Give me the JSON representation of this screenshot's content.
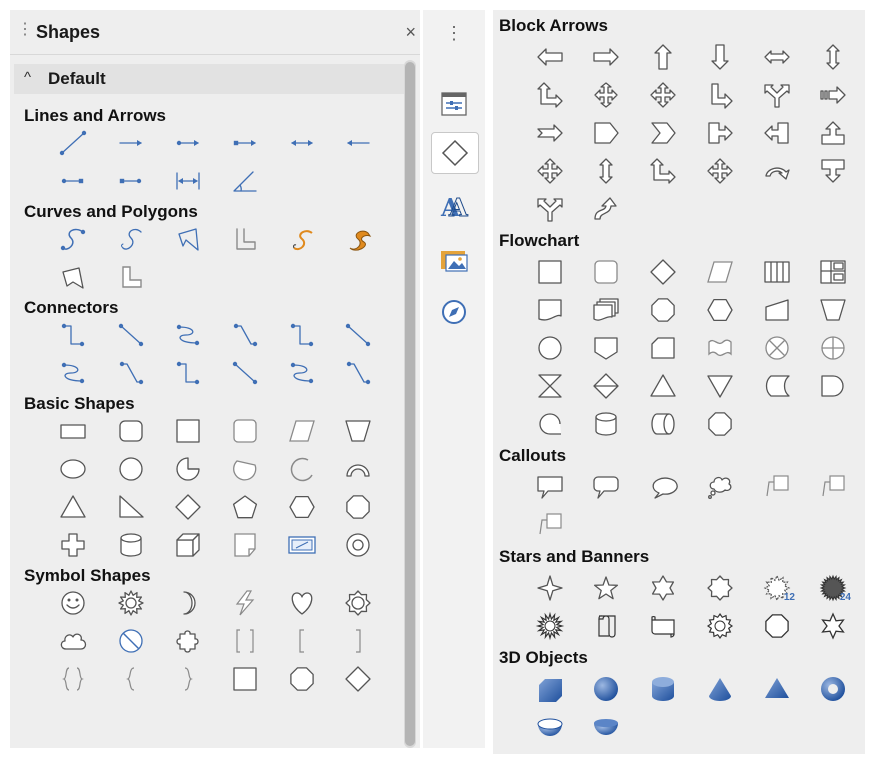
{
  "panel": {
    "title": "Shapes",
    "close_label": "×",
    "group_label": "Default"
  },
  "sidebar_tabs": [
    "properties",
    "shapes",
    "styles",
    "gallery",
    "navigator"
  ],
  "left_sections": [
    {
      "title": "Lines and Arrows",
      "shapes": [
        {
          "name": "line-icon",
          "icon": "line"
        },
        {
          "name": "line-ends-arrow-icon",
          "icon": "arrowR"
        },
        {
          "name": "line-starts-circle-arrow-icon",
          "icon": "circArrow"
        },
        {
          "name": "line-starts-square-arrow-icon",
          "icon": "sqArrow"
        },
        {
          "name": "line-arrows-both-icon",
          "icon": "dblArrow"
        },
        {
          "name": "line-starts-arrow-icon",
          "icon": "arrowL"
        },
        {
          "name": "line-circle-square-icon",
          "icon": "circSq"
        },
        {
          "name": "line-square-circle-icon",
          "icon": "sqCirc"
        },
        {
          "name": "dimension-line-icon",
          "icon": "dimLine"
        },
        {
          "name": "line-angle-icon",
          "icon": "angle"
        }
      ]
    },
    {
      "title": "Curves and Polygons",
      "shapes": [
        {
          "name": "curve-icon",
          "icon": "curve"
        },
        {
          "name": "curve-outline-icon",
          "icon": "curveOutline"
        },
        {
          "name": "polygon-icon",
          "icon": "polygon"
        },
        {
          "name": "polygon-45-icon",
          "icon": "poly45"
        },
        {
          "name": "freeform-line-icon",
          "icon": "freeform"
        },
        {
          "name": "freeform-filled-icon",
          "icon": "freeformFilled"
        },
        {
          "name": "polygon-filled-icon",
          "icon": "polygonFilled"
        },
        {
          "name": "polygon-45-filled-icon",
          "icon": "poly45Filled"
        }
      ]
    },
    {
      "title": "Connectors",
      "shapes": [
        {
          "name": "connector-icon",
          "icon": "conn1"
        },
        {
          "name": "straight-connector-icon",
          "icon": "conn2"
        },
        {
          "name": "curved-connector-icon",
          "icon": "conn3"
        },
        {
          "name": "line-connector-icon",
          "icon": "conn4"
        },
        {
          "name": "connector-ends-arrow-icon",
          "icon": "conn1"
        },
        {
          "name": "straight-connector-arrow-icon",
          "icon": "conn2"
        },
        {
          "name": "curved-connector-arrow-icon",
          "icon": "conn3"
        },
        {
          "name": "line-connector-arrow-icon",
          "icon": "conn4"
        },
        {
          "name": "connector-circles-icon",
          "icon": "conn1"
        },
        {
          "name": "straight-connector-circles-icon",
          "icon": "conn2"
        },
        {
          "name": "curved-connector-circles-icon",
          "icon": "conn3"
        },
        {
          "name": "line-connector-circles-icon",
          "icon": "conn4"
        }
      ]
    },
    {
      "title": "Basic Shapes",
      "shapes": [
        {
          "name": "rectangle-icon",
          "icon": "rect"
        },
        {
          "name": "rounded-rectangle-icon",
          "icon": "roundRect"
        },
        {
          "name": "square-icon",
          "icon": "square"
        },
        {
          "name": "rounded-square-icon",
          "icon": "roundSquare"
        },
        {
          "name": "parallelogram-icon",
          "icon": "parallelogram"
        },
        {
          "name": "trapezoid-icon",
          "icon": "trapezoid"
        },
        {
          "name": "ellipse-icon",
          "icon": "ellipse"
        },
        {
          "name": "circle-icon",
          "icon": "circle"
        },
        {
          "name": "circle-pie-icon",
          "icon": "pie"
        },
        {
          "name": "circle-segment-icon",
          "icon": "chord"
        },
        {
          "name": "arc-icon",
          "icon": "arc"
        },
        {
          "name": "block-arc-icon",
          "icon": "blockArc"
        },
        {
          "name": "isosceles-triangle-icon",
          "icon": "triangle"
        },
        {
          "name": "right-triangle-icon",
          "icon": "rightTriangle"
        },
        {
          "name": "diamond-icon",
          "icon": "diamond"
        },
        {
          "name": "pentagon-icon",
          "icon": "pentagon"
        },
        {
          "name": "hexagon-icon",
          "icon": "hexagon"
        },
        {
          "name": "octagon-icon",
          "icon": "octagon"
        },
        {
          "name": "cross-icon",
          "icon": "cross"
        },
        {
          "name": "cylinder-icon",
          "icon": "cylinder"
        },
        {
          "name": "cube-icon",
          "icon": "cube"
        },
        {
          "name": "folded-corner-icon",
          "icon": "folded"
        },
        {
          "name": "frame-icon",
          "icon": "frame"
        },
        {
          "name": "ring-icon",
          "icon": "ring"
        }
      ]
    },
    {
      "title": "Symbol Shapes",
      "shapes": [
        {
          "name": "smiley-face-icon",
          "icon": "smiley"
        },
        {
          "name": "sun-icon",
          "icon": "sun"
        },
        {
          "name": "moon-icon",
          "icon": "moon"
        },
        {
          "name": "lightning-icon",
          "icon": "lightning"
        },
        {
          "name": "heart-icon",
          "icon": "heart"
        },
        {
          "name": "flower-icon",
          "icon": "flower"
        },
        {
          "name": "cloud-icon",
          "icon": "cloud"
        },
        {
          "name": "prohibited-icon",
          "icon": "prohibited"
        },
        {
          "name": "puzzle-icon",
          "icon": "puzzle"
        },
        {
          "name": "bracket-pair-icon",
          "icon": "brackets"
        },
        {
          "name": "left-bracket-icon",
          "icon": "leftBracket"
        },
        {
          "name": "right-bracket-icon",
          "icon": "rightBracket"
        },
        {
          "name": "brace-pair-icon",
          "icon": "braces"
        },
        {
          "name": "left-brace-icon",
          "icon": "leftBrace"
        },
        {
          "name": "right-brace-icon",
          "icon": "rightBrace"
        },
        {
          "name": "square-bevel-icon",
          "icon": "squareBevel"
        },
        {
          "name": "octagon-bevel-icon",
          "icon": "octagonBevel"
        },
        {
          "name": "diamond-bevel-icon",
          "icon": "diamond"
        }
      ]
    }
  ],
  "right_sections": [
    {
      "title": "Block Arrows",
      "shapes": [
        {
          "name": "left-arrow-icon",
          "icon": "baLeft"
        },
        {
          "name": "right-arrow-icon",
          "icon": "baRight"
        },
        {
          "name": "up-arrow-icon",
          "icon": "baUp"
        },
        {
          "name": "down-arrow-icon",
          "icon": "baDown"
        },
        {
          "name": "left-right-arrow-icon",
          "icon": "baLR"
        },
        {
          "name": "up-down-arrow-icon",
          "icon": "baUD"
        },
        {
          "name": "up-right-arrow-icon",
          "icon": "baUR"
        },
        {
          "name": "up-right-down-arrow-icon",
          "icon": "baURD"
        },
        {
          "name": "four-way-arrow-icon",
          "icon": "ba4"
        },
        {
          "name": "corner-right-arrow-icon",
          "icon": "baCorner"
        },
        {
          "name": "split-arrow-icon",
          "icon": "baSplit"
        },
        {
          "name": "striped-right-arrow-icon",
          "icon": "baStriped"
        },
        {
          "name": "notched-right-arrow-icon",
          "icon": "baNotched"
        },
        {
          "name": "pentagon-arrow-icon",
          "icon": "baPentagon"
        },
        {
          "name": "chevron-icon",
          "icon": "baChevron"
        },
        {
          "name": "right-arrow-callout-icon",
          "icon": "baCallR"
        },
        {
          "name": "left-arrow-callout-icon",
          "icon": "baCallL"
        },
        {
          "name": "up-arrow-callout-icon",
          "icon": "baCallU"
        },
        {
          "name": "four-way-arrow-callout-icon",
          "icon": "ba4"
        },
        {
          "name": "up-down-arrow-callout-icon",
          "icon": "baUD"
        },
        {
          "name": "up-right-arrow-callout-icon",
          "icon": "baUR"
        },
        {
          "name": "diamond-arrows-icon",
          "icon": "ba4"
        },
        {
          "name": "circular-arrow-icon",
          "icon": "baCircular"
        },
        {
          "name": "down-arrow-callout-icon",
          "icon": "baCallD"
        },
        {
          "name": "split-round-arrow-icon",
          "icon": "baSplit"
        },
        {
          "name": "s-shaped-arrow-icon",
          "icon": "baS"
        }
      ]
    },
    {
      "title": "Flowchart",
      "shapes": [
        {
          "name": "flowchart-process-icon",
          "icon": "square"
        },
        {
          "name": "flowchart-alternate-process-icon",
          "icon": "roundSquare"
        },
        {
          "name": "flowchart-decision-icon",
          "icon": "diamond"
        },
        {
          "name": "flowchart-data-icon",
          "icon": "parallelogram"
        },
        {
          "name": "flowchart-predefined-process-icon",
          "icon": "predefined"
        },
        {
          "name": "flowchart-internal-storage-icon",
          "icon": "internal"
        },
        {
          "name": "flowchart-document-icon",
          "icon": "document"
        },
        {
          "name": "flowchart-multidocument-icon",
          "icon": "multidoc"
        },
        {
          "name": "flowchart-terminator-icon",
          "icon": "octagon"
        },
        {
          "name": "flowchart-preparation-icon",
          "icon": "hexagon"
        },
        {
          "name": "flowchart-manual-input-icon",
          "icon": "manualInput"
        },
        {
          "name": "flowchart-manual-operation-icon",
          "icon": "trapezoid"
        },
        {
          "name": "flowchart-connector-icon",
          "icon": "circle"
        },
        {
          "name": "flowchart-off-page-connector-icon",
          "icon": "offpage"
        },
        {
          "name": "flowchart-card-icon",
          "icon": "card"
        },
        {
          "name": "flowchart-punched-tape-icon",
          "icon": "tape"
        },
        {
          "name": "flowchart-summing-junction-icon",
          "icon": "summing"
        },
        {
          "name": "flowchart-or-icon",
          "icon": "orShape"
        },
        {
          "name": "flowchart-collate-icon",
          "icon": "collate"
        },
        {
          "name": "flowchart-sort-icon",
          "icon": "sort"
        },
        {
          "name": "flowchart-extract-icon",
          "icon": "triangle"
        },
        {
          "name": "flowchart-merge-icon",
          "icon": "merge"
        },
        {
          "name": "flowchart-stored-data-icon",
          "icon": "storedData"
        },
        {
          "name": "flowchart-delay-icon",
          "icon": "delay"
        },
        {
          "name": "flowchart-sequential-access-icon",
          "icon": "sequential"
        },
        {
          "name": "flowchart-magnetic-disc-icon",
          "icon": "cylinder"
        },
        {
          "name": "flowchart-direct-access-storage-icon",
          "icon": "directAccess"
        },
        {
          "name": "flowchart-display-icon",
          "icon": "octagon"
        }
      ]
    },
    {
      "title": "Callouts",
      "shapes": [
        {
          "name": "rectangular-callout-icon",
          "icon": "callRect"
        },
        {
          "name": "rounded-rectangular-callout-icon",
          "icon": "callRound"
        },
        {
          "name": "round-callout-icon",
          "icon": "callOval"
        },
        {
          "name": "cloud-callout-icon",
          "icon": "callCloud"
        },
        {
          "name": "line-callout-1-icon",
          "icon": "callLine"
        },
        {
          "name": "line-callout-2-icon",
          "icon": "callLine"
        },
        {
          "name": "line-callout-3-icon",
          "icon": "callLine"
        }
      ]
    },
    {
      "title": "Stars and Banners",
      "shapes": [
        {
          "name": "4-point-star-icon",
          "icon": "star4"
        },
        {
          "name": "5-point-star-icon",
          "icon": "star5"
        },
        {
          "name": "6-point-star-icon",
          "icon": "star6"
        },
        {
          "name": "8-point-star-icon",
          "icon": "star8"
        },
        {
          "name": "12-point-star-icon",
          "icon": "star12",
          "badge": "12"
        },
        {
          "name": "24-point-star-icon",
          "icon": "star24",
          "badge": "24"
        },
        {
          "name": "explosion-icon",
          "icon": "explosion"
        },
        {
          "name": "vertical-scroll-icon",
          "icon": "vscroll"
        },
        {
          "name": "horizontal-scroll-icon",
          "icon": "hscroll"
        },
        {
          "name": "signet-icon",
          "icon": "signet"
        },
        {
          "name": "doorplate-icon",
          "icon": "doorplate"
        },
        {
          "name": "concave-star-icon",
          "icon": "concaveStar"
        }
      ]
    },
    {
      "title": "3D Objects",
      "shapes": [
        {
          "name": "3d-cube-icon",
          "icon": "d3cube"
        },
        {
          "name": "3d-sphere-icon",
          "icon": "d3sphere"
        },
        {
          "name": "3d-cylinder-icon",
          "icon": "d3cyl"
        },
        {
          "name": "3d-cone-icon",
          "icon": "d3cone"
        },
        {
          "name": "3d-pyramid-icon",
          "icon": "d3pyramid"
        },
        {
          "name": "3d-torus-icon",
          "icon": "d3torus"
        },
        {
          "name": "3d-shell-icon",
          "icon": "d3shell"
        },
        {
          "name": "3d-half-sphere-icon",
          "icon": "d3half"
        }
      ]
    }
  ],
  "colors": {
    "panel_bg": "#eeeeee",
    "accent_blue": "#3f6fb5",
    "gray_stroke": "#555555",
    "light_stroke": "#8a8a8a",
    "freeform_orange": "#e08a1e"
  }
}
